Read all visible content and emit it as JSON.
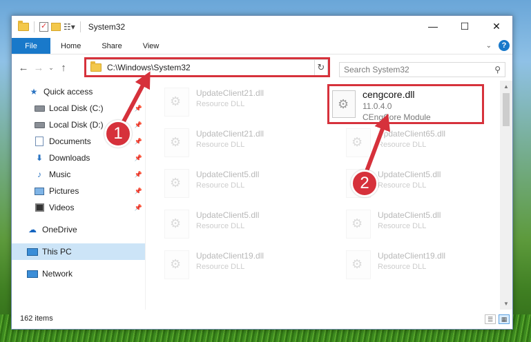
{
  "window": {
    "title": "System32",
    "controls": {
      "minimize": "—",
      "maximize": "☐",
      "close": "✕"
    }
  },
  "ribbon": {
    "tabs": [
      {
        "label": "File",
        "active": true
      },
      {
        "label": "Home"
      },
      {
        "label": "Share"
      },
      {
        "label": "View"
      }
    ],
    "help_label": "?"
  },
  "address": {
    "path": "C:\\Windows\\System32",
    "search_placeholder": "Search System32"
  },
  "sidebar": {
    "items": [
      {
        "label": "Quick access",
        "icon": "star-icon"
      },
      {
        "label": "Local Disk (C:)",
        "icon": "drive-icon",
        "pinned": true
      },
      {
        "label": "Local Disk (D:)",
        "icon": "drive-icon",
        "pinned": true
      },
      {
        "label": "Documents",
        "icon": "document-icon",
        "pinned": true
      },
      {
        "label": "Downloads",
        "icon": "download-icon",
        "pinned": true
      },
      {
        "label": "Music",
        "icon": "music-icon",
        "pinned": true
      },
      {
        "label": "Pictures",
        "icon": "pictures-icon",
        "pinned": true
      },
      {
        "label": "Videos",
        "icon": "videos-icon",
        "pinned": true
      },
      {
        "label": "OneDrive",
        "icon": "onedrive-icon"
      },
      {
        "label": "This PC",
        "icon": "this-pc-icon",
        "selected": true
      },
      {
        "label": "Network",
        "icon": "network-icon"
      }
    ]
  },
  "files": {
    "left_column": [
      {
        "name": "UpdateClient21.dll",
        "type": "Resource DLL"
      },
      {
        "name": "UpdateClient21.dll",
        "type": "Resource DLL"
      },
      {
        "name": "UpdateClient5.dll",
        "type": "Resource DLL"
      },
      {
        "name": "UpdateClient5.dll",
        "type": "Resource DLL"
      },
      {
        "name": "UpdateClient19.dll",
        "type": "Resource DLL"
      }
    ],
    "right_column": [
      {
        "name": "UpdateClient65.dll",
        "type": "Resource DLL"
      },
      {
        "name": "UpdateClient5.dll",
        "type": "Resource DLL"
      },
      {
        "name": "UpdateClient5.dll",
        "type": "Resource DLL"
      },
      {
        "name": "UpdateClient19.dll",
        "type": "Resource DLL"
      }
    ],
    "highlighted": {
      "name": "cengcore.dll",
      "version": "11.0.4.0",
      "description": "CEngCore Module"
    }
  },
  "status": {
    "item_count": "162 items"
  },
  "annotations": {
    "step1": "1",
    "step2": "2",
    "color": "#d6313b"
  }
}
